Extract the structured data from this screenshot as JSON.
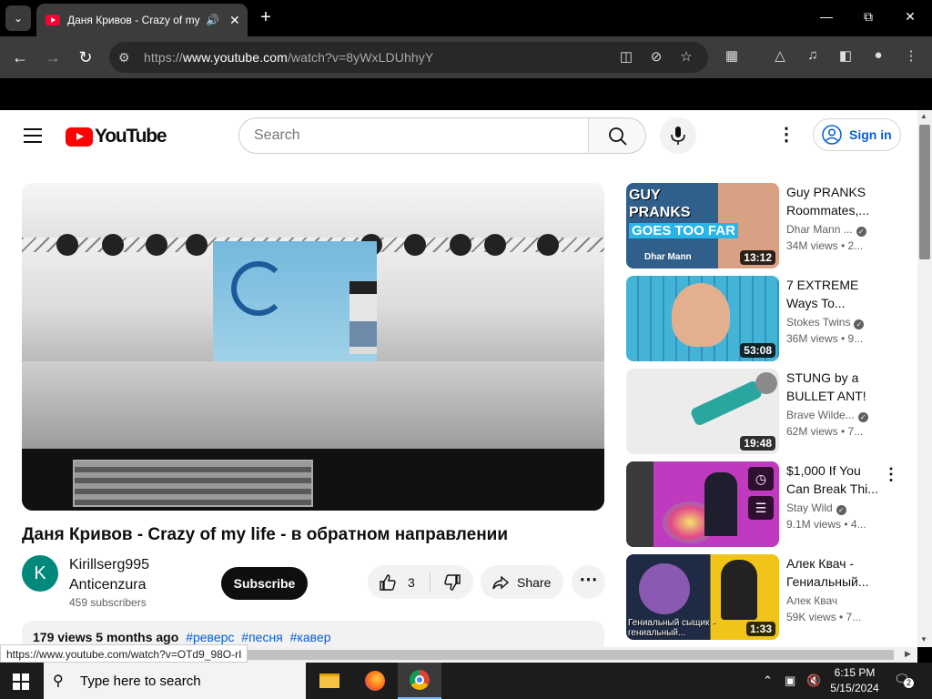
{
  "browser": {
    "tab_title": "Даня Кривов - Crazy of my life - в обратном направлении",
    "url_scheme": "https://",
    "url_host": "www.youtube.com",
    "url_path": "/watch?v=8yWxLDUhhyY"
  },
  "youtube": {
    "logo_text": "YouTube",
    "search_placeholder": "Search",
    "sign_in_label": "Sign in"
  },
  "video": {
    "title": "Даня Кривов - Crazy of my life - в обратном направлении",
    "channel_line1": "Kirillserg995",
    "channel_line2": "Anticenzura",
    "channel_initial": "K",
    "subscribers": "459 subscribers",
    "subscribe_label": "Subscribe",
    "like_count": "3",
    "share_label": "Share",
    "description_stats": "179 views  5 months ago",
    "tags": [
      "#реверс",
      "#песня",
      "#кавер"
    ]
  },
  "recommendations": [
    {
      "title": "Guy PRANKS Roommates,...",
      "channel": "Dhar Mann ...",
      "verified": true,
      "stats": "34M views  • 2...",
      "duration": "13:12",
      "thumb_color": "#3b6f9a",
      "thumb_text": "GUY PRANKS ROOMMATES",
      "thumb_text2": "GOES TOO FAR",
      "thumb_text3": "Dhar Mann"
    },
    {
      "title": "7 EXTREME Ways To...",
      "channel": "Stokes Twins",
      "verified": true,
      "stats": "36M views  • 9...",
      "duration": "53:08",
      "thumb_color": "#3aa8c9",
      "thumb_text": "",
      "thumb_text2": "",
      "thumb_text3": ""
    },
    {
      "title": "STUNG by a BULLET ANT!",
      "channel": "Brave Wilde...",
      "verified": true,
      "stats": "62M views  • 7...",
      "duration": "19:48",
      "thumb_color": "#e9e9e9",
      "thumb_text": "",
      "thumb_text2": "",
      "thumb_text3": ""
    },
    {
      "title": "$1,000 If You Can Break Thi...",
      "channel": "Stay Wild",
      "verified": true,
      "stats": "9.1M views  • 4...",
      "duration": "",
      "thumb_color": "#b03ab0",
      "thumb_text": "",
      "thumb_text2": "",
      "thumb_text3": ""
    },
    {
      "title": "Алек Квач - Гениальный...",
      "channel": "Алек Квач",
      "verified": false,
      "stats": "59K views  • 7...",
      "duration": "1:33",
      "thumb_color": "#e7b21c",
      "thumb_text": "Гениальный сыщик -",
      "thumb_text2": "гениальный... ",
      "thumb_text3": ""
    }
  ],
  "status_bar_url": "https://www.youtube.com/watch?v=OTd9_98O-rI",
  "taskbar": {
    "search_placeholder": "Type here to search",
    "time": "6:15 PM",
    "date": "5/15/2024",
    "notification_count": "2"
  }
}
